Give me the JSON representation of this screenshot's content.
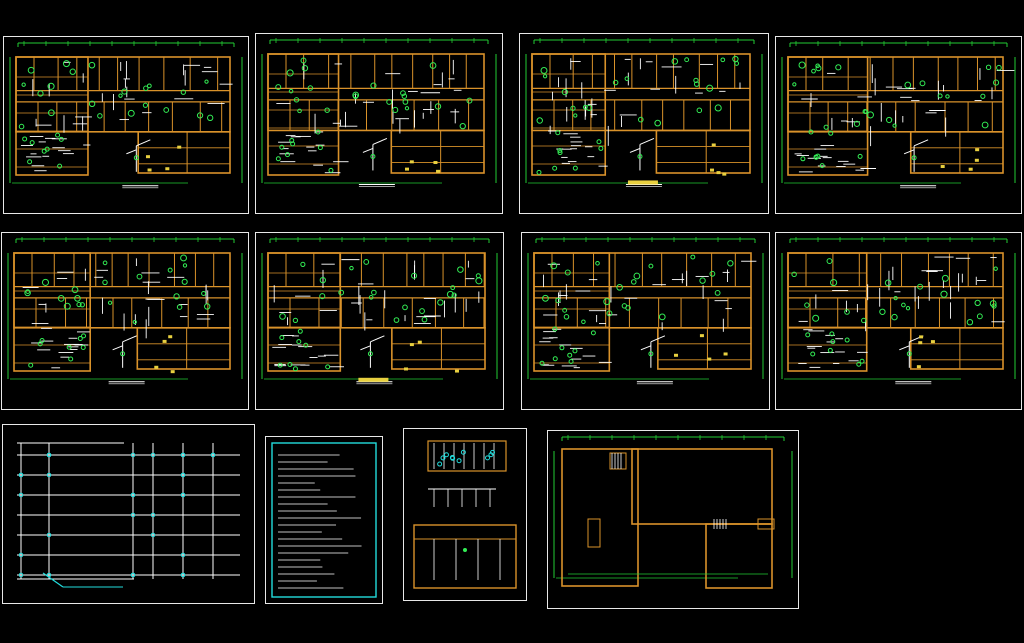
{
  "app": {
    "title": "",
    "background": "#000000"
  },
  "colors": {
    "wall": "#d9922a",
    "dimension": "#22cc33",
    "pipe": "#ffffff",
    "fixture": "#33ee55",
    "accent_cyan": "#22dddd",
    "frame": "#e8e8e8",
    "yellow": "#e8d040"
  },
  "sheets": [
    {
      "id": "sheet-1",
      "kind": "floor-plan",
      "variant": "a"
    },
    {
      "id": "sheet-2",
      "kind": "floor-plan",
      "variant": "b"
    },
    {
      "id": "sheet-3",
      "kind": "floor-plan",
      "variant": "c"
    },
    {
      "id": "sheet-4",
      "kind": "floor-plan",
      "variant": "d"
    },
    {
      "id": "sheet-5",
      "kind": "floor-plan",
      "variant": "e"
    },
    {
      "id": "sheet-6",
      "kind": "floor-plan",
      "variant": "f"
    },
    {
      "id": "sheet-7",
      "kind": "floor-plan",
      "variant": "g"
    },
    {
      "id": "sheet-8",
      "kind": "floor-plan",
      "variant": "h"
    },
    {
      "id": "sheet-9",
      "kind": "riser-diagram"
    },
    {
      "id": "sheet-10",
      "kind": "notes-sheet"
    },
    {
      "id": "sheet-11",
      "kind": "detail-sheet"
    },
    {
      "id": "sheet-12",
      "kind": "roof-plan"
    }
  ]
}
